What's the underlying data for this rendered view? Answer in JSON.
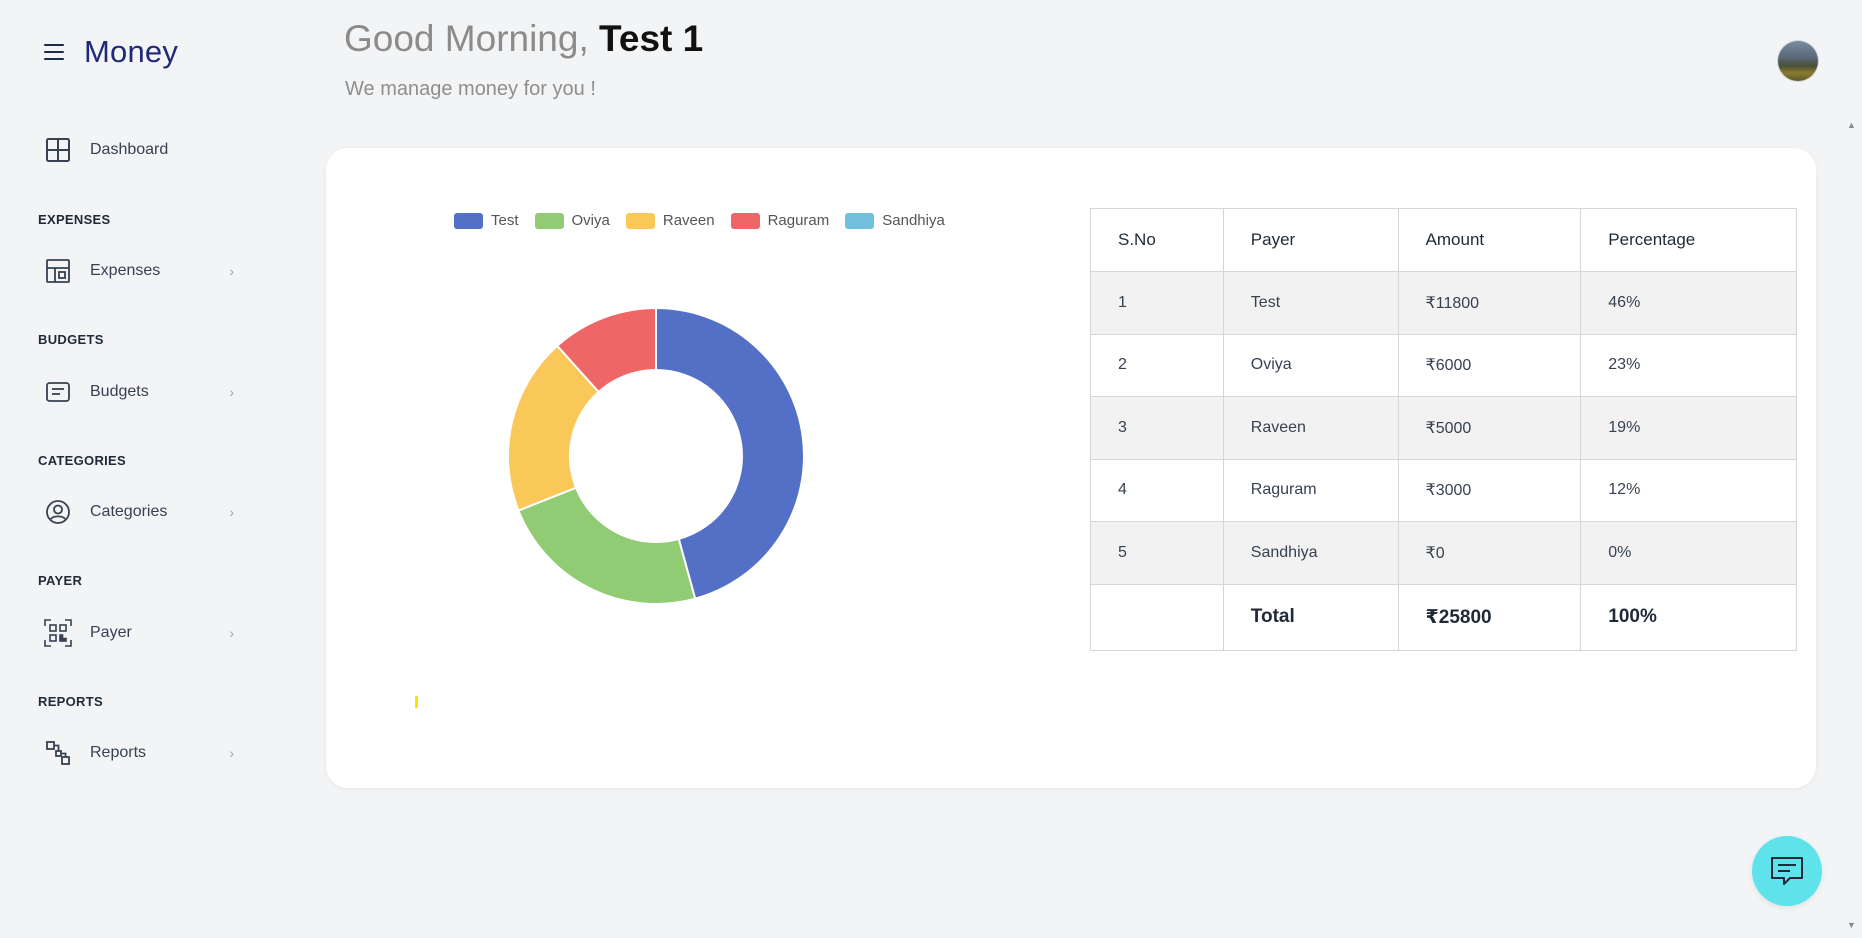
{
  "app": {
    "title": "Money"
  },
  "header": {
    "greeting_prefix": "Good Morning, ",
    "user_name": "Test 1",
    "subtitle": "We manage money for you !"
  },
  "sidebar": {
    "dashboard": {
      "label": "Dashboard",
      "icon": "dashboard-grid-icon"
    },
    "sections": [
      {
        "title": "EXPENSES",
        "item": {
          "label": "Expenses",
          "icon": "expenses-layout-icon"
        }
      },
      {
        "title": "BUDGETS",
        "item": {
          "label": "Budgets",
          "icon": "budgets-doc-icon"
        }
      },
      {
        "title": "CATEGORIES",
        "item": {
          "label": "Categories",
          "icon": "user-circle-icon"
        }
      },
      {
        "title": "PAYER",
        "item": {
          "label": "Payer",
          "icon": "qr-code-icon"
        }
      },
      {
        "title": "REPORTS",
        "item": {
          "label": "Reports",
          "icon": "reports-nodes-icon"
        }
      }
    ],
    "chevron": "›"
  },
  "chart_data": {
    "type": "pie",
    "variant": "doughnut",
    "legend_position": "top",
    "categories": [
      "Test",
      "Oviya",
      "Raveen",
      "Raguram",
      "Sandhiya"
    ],
    "values": [
      11800,
      6000,
      5000,
      3000,
      0
    ],
    "colors": [
      "#5470c6",
      "#91cc75",
      "#fac858",
      "#ee6666",
      "#73c0de"
    ]
  },
  "table": {
    "headers": [
      "S.No",
      "Payer",
      "Amount",
      "Percentage"
    ],
    "rows": [
      [
        "1",
        "Test",
        "₹11800",
        "46%"
      ],
      [
        "2",
        "Oviya",
        "₹6000",
        "23%"
      ],
      [
        "3",
        "Raveen",
        "₹5000",
        "19%"
      ],
      [
        "4",
        "Raguram",
        "₹3000",
        "12%"
      ],
      [
        "5",
        "Sandhiya",
        "₹0",
        "0%"
      ]
    ],
    "footer": {
      "sno": "",
      "label": "Total",
      "amount": "₹25800",
      "percentage": "100%"
    }
  },
  "scrollbar": {
    "up": "▲",
    "down": "▼"
  },
  "chat": {
    "icon": "chat-message-icon"
  }
}
